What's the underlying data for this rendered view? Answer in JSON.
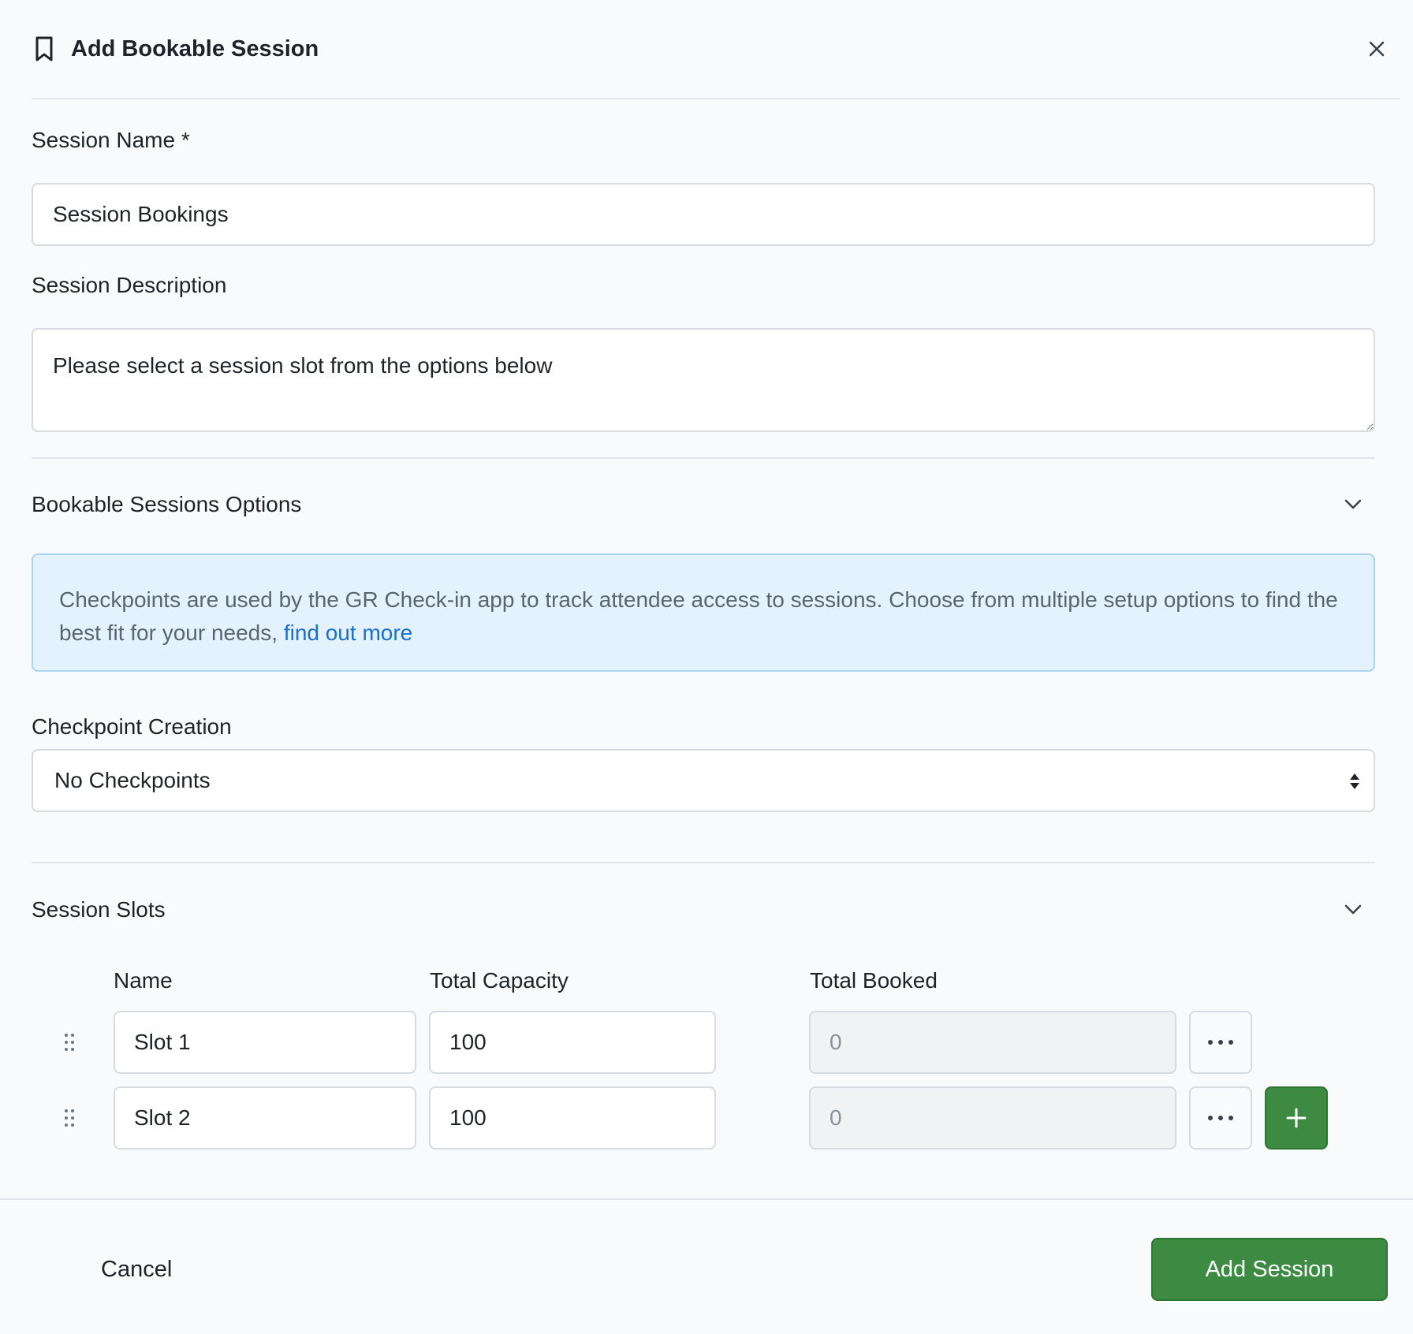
{
  "modal": {
    "title": "Add Bookable Session",
    "icon": "bookmark-icon",
    "close_icon": "close-icon"
  },
  "form": {
    "session_name_label": "Session Name *",
    "session_name_value": "Session Bookings",
    "session_description_label": "Session Description",
    "session_description_value": "Please select a session slot from the options below"
  },
  "options_section": {
    "title": "Bookable Sessions Options",
    "info_text": "Checkpoints are used by the GR Check-in app to track attendee access to sessions. Choose from multiple setup options to find the best fit for your needs, ",
    "info_link": "find out more",
    "checkpoint_label": "Checkpoint Creation",
    "checkpoint_selected": "No Checkpoints"
  },
  "slots_section": {
    "title": "Session Slots",
    "columns": [
      "Name",
      "Total Capacity",
      "Total Booked"
    ],
    "rows": [
      {
        "name": "Slot 1",
        "capacity": "100",
        "booked": "0"
      },
      {
        "name": "Slot 2",
        "capacity": "100",
        "booked": "0"
      }
    ]
  },
  "footer": {
    "cancel_label": "Cancel",
    "submit_label": "Add Session"
  },
  "colors": {
    "primary_green": "#3d8a42",
    "info_bg": "#e3f2fc",
    "link_blue": "#1a6fd1"
  }
}
